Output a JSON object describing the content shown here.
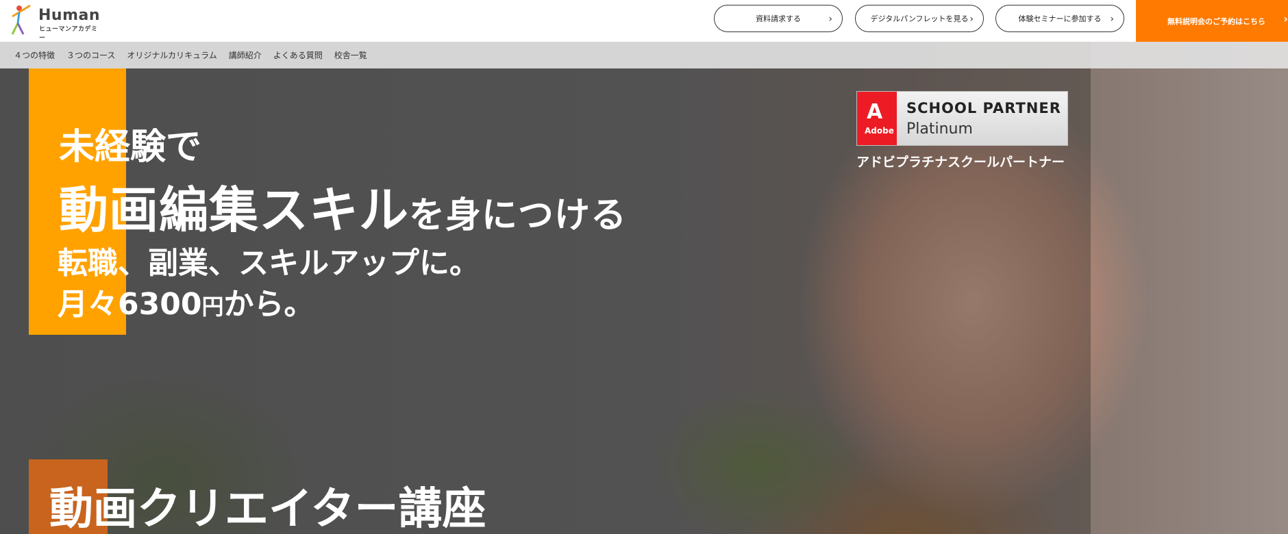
{
  "header": {
    "logo_name": "Human",
    "logo_sub": "ヒューマンアカデミー",
    "buttons": [
      {
        "label": "資料請求する"
      },
      {
        "label": "デジタルパンフレットを見る"
      },
      {
        "label": "体験セミナーに参加する"
      }
    ],
    "cta_label": "無料説明会のご予約はこちら",
    "chevron": "›"
  },
  "subnav": {
    "items": [
      {
        "label": "４つの特徴"
      },
      {
        "label": "３つのコース"
      },
      {
        "label": "オリジナルカリキュラム"
      },
      {
        "label": "講師紹介"
      },
      {
        "label": "よくある質問"
      },
      {
        "label": "校舎一覧"
      }
    ]
  },
  "hero": {
    "line1": "未経験で",
    "line2_main": "動画編集スキル",
    "line2_tail": "を身につける",
    "line3": "転職、副業、スキルアップに。",
    "line4_pre": "月々6300",
    "line4_yen": "円",
    "line4_post": "から。",
    "course_title": "動画クリエイター講座"
  },
  "badge": {
    "brand": "Adobe",
    "brand_mark": "A",
    "title": "SCHOOL PARTNER",
    "level": "Platinum",
    "caption": "アドビプラチナスクールパートナー"
  },
  "colors": {
    "accent_orange": "#ffa200",
    "cta_orange": "#ff7a00",
    "adobe_red": "#ed1c24"
  }
}
